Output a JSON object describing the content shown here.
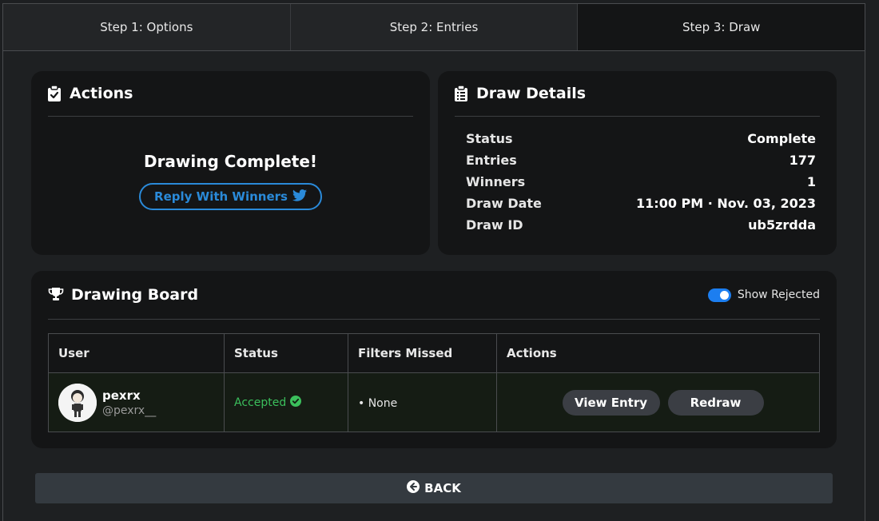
{
  "tabs": [
    {
      "label": "Step 1: Options"
    },
    {
      "label": "Step 2: Entries"
    },
    {
      "label": "Step 3: Draw"
    }
  ],
  "actions": {
    "title": "Actions",
    "message": "Drawing Complete!",
    "reply_label": "Reply With Winners",
    "accent": "#2a8ad9"
  },
  "draw_details": {
    "title": "Draw Details",
    "rows": [
      {
        "key": "Status",
        "value": "Complete"
      },
      {
        "key": "Entries",
        "value": "177"
      },
      {
        "key": "Winners",
        "value": "1"
      },
      {
        "key": "Draw Date",
        "value": "11:00 PM · Nov. 03, 2023"
      },
      {
        "key": "Draw ID",
        "value": "ub5zrdda"
      }
    ]
  },
  "board": {
    "title": "Drawing Board",
    "toggle_label": "Show Rejected",
    "toggle_on": true,
    "columns": [
      "User",
      "Status",
      "Filters Missed",
      "Actions"
    ],
    "rows": [
      {
        "name": "pexrx",
        "handle": "@pexrx__",
        "status": "Accepted",
        "filters": "• None",
        "view_label": "View Entry",
        "redraw_label": "Redraw"
      }
    ]
  },
  "back_label": "BACK",
  "colors": {
    "background": "#1d1f21",
    "card": "#141516",
    "accepted": "#3bbf5c",
    "toggle": "#1c7ef0"
  }
}
